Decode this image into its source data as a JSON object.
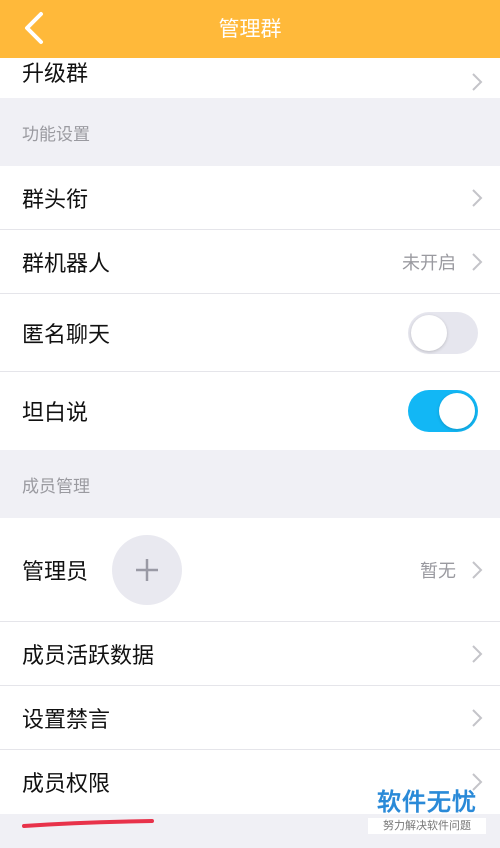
{
  "header": {
    "title": "管理群",
    "back_icon": "chevron-left-icon"
  },
  "rows": {
    "upgrade": "升级群",
    "group_title": "群头衔",
    "group_robot": "群机器人",
    "group_robot_value": "未开启",
    "anonymous_chat": "匿名聊天",
    "anonymous_chat_on": false,
    "candid_say": "坦白说",
    "candid_say_on": true,
    "admin": "管理员",
    "admin_value": "暂无",
    "activity_data": "成员活跃数据",
    "mute_settings": "设置禁言",
    "member_permissions": "成员权限"
  },
  "sections": {
    "features": "功能设置",
    "members": "成员管理"
  },
  "watermark": {
    "main": "软件无忧",
    "sub": "努力解决软件问题"
  },
  "colors": {
    "header_bg": "#ffb93a",
    "toggle_on": "#12b7f5",
    "toggle_off": "#e6e6ee",
    "underline": "#e8324a",
    "watermark": "#2a8ad8"
  }
}
